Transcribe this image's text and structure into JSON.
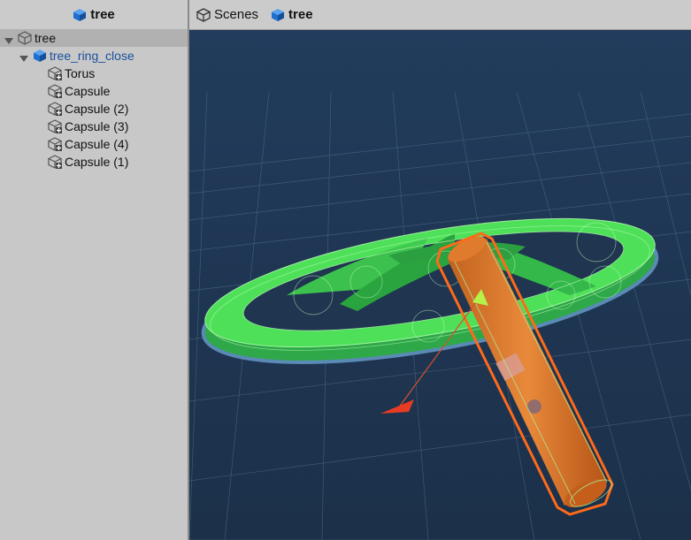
{
  "hierarchy": {
    "header_title": "tree",
    "root": {
      "label": "tree",
      "expanded": true
    },
    "prefab": {
      "label": "tree_ring_close",
      "expanded": true
    },
    "children": [
      {
        "label": "Torus"
      },
      {
        "label": "Capsule"
      },
      {
        "label": "Capsule (2)"
      },
      {
        "label": "Capsule (3)"
      },
      {
        "label": "Capsule (4)"
      },
      {
        "label": "Capsule (1)"
      }
    ]
  },
  "scene": {
    "breadcrumb_scenes": "Scenes",
    "breadcrumb_prefab": "tree"
  },
  "colors": {
    "prefab_blue": "#1f6fd1",
    "selection_green": "#3ee04a",
    "capsule_orange": "#e86a10",
    "viewport_bg": "#1f3550"
  }
}
